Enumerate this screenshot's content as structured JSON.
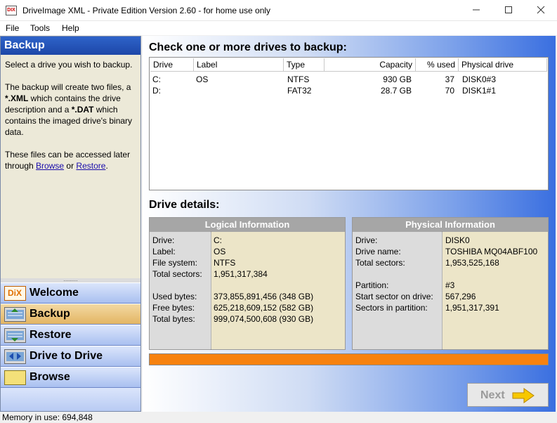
{
  "window": {
    "title": "DriveImage XML - Private Edition Version 2.60 - for home use only",
    "icon_text": "DIX"
  },
  "menu": [
    {
      "label": "File"
    },
    {
      "label": "Tools"
    },
    {
      "label": "Help"
    }
  ],
  "left_panel": {
    "title": "Backup",
    "intro": "Select a drive you wish to backup.",
    "desc_part1": "The backup will create two files, a ",
    "xml_ext": "*.XML",
    "desc_part2": " which contains the drive description and a ",
    "dat_ext": "*.DAT",
    "desc_part3": " which contains the imaged drive's binary data.",
    "access_part1": "These files can be accessed later through ",
    "browse_link": "Browse",
    "or_text": " or ",
    "restore_link": "Restore",
    "period": ".",
    "splitter_grip": "........."
  },
  "nav": {
    "welcome": "Welcome",
    "welcome_icon": "DiX",
    "backup": "Backup",
    "restore": "Restore",
    "drive_to_drive": "Drive to Drive",
    "browse": "Browse"
  },
  "main": {
    "heading": "Check one or more drives to backup:",
    "details_heading": "Drive details:",
    "next_label": "Next"
  },
  "drive_table": {
    "columns": {
      "drive": "Drive",
      "label": "Label",
      "type": "Type",
      "capacity": "Capacity",
      "used": "% used",
      "physical": "Physical drive"
    },
    "rows": [
      {
        "drive": "C:",
        "label": "OS",
        "type": "NTFS",
        "capacity": "930 GB",
        "used": "37",
        "physical": "DISK0#3"
      },
      {
        "drive": "D:",
        "label": "",
        "type": "FAT32",
        "capacity": "28.7 GB",
        "used": "70",
        "physical": "DISK1#1"
      }
    ]
  },
  "logical": {
    "title": "Logical Information",
    "drive_label": "Drive:",
    "drive_value": "C:",
    "label_label": "Label:",
    "label_value": "OS",
    "fs_label": "File system:",
    "fs_value": "NTFS",
    "sectors_label": "Total sectors:",
    "sectors_value": "1,951,317,384",
    "used_label": "Used bytes:",
    "used_value": "373,855,891,456 (348 GB)",
    "free_label": "Free bytes:",
    "free_value": "625,218,609,152 (582 GB)",
    "total_label": "Total bytes:",
    "total_value": "999,074,500,608 (930 GB)"
  },
  "physical": {
    "title": "Physical Information",
    "drive_label": "Drive:",
    "drive_value": "DISK0",
    "name_label": "Drive name:",
    "name_value": "TOSHIBA MQ04ABF100",
    "sectors_label": "Total sectors:",
    "sectors_value": "1,953,525,168",
    "partition_label": "Partition:",
    "partition_value": "#3",
    "start_label": "Start sector on drive:",
    "start_value": "567,296",
    "sip_label": "Sectors in partition:",
    "sip_value": "1,951,317,391"
  },
  "progress": {
    "fraction": 1.0,
    "color": "#f7820f"
  },
  "status": {
    "memory": "Memory in use: 694,848"
  },
  "colors": {
    "accent": "#2e63c9",
    "active_nav": "#e3b563",
    "progress": "#f7820f"
  }
}
